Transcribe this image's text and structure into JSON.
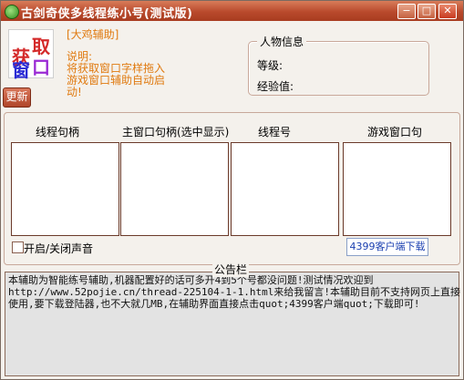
{
  "window": {
    "title": "古剑奇侠多线程练小号(测试版)",
    "buttons": {
      "minimize": "−",
      "maximize": "□",
      "close": "✕"
    }
  },
  "logo": {
    "chars": [
      "获",
      "取",
      "窗",
      "口"
    ]
  },
  "helper": {
    "title": "[大鸡辅助]",
    "desc_lines": [
      "说明:",
      "将获取窗口字样拖入",
      "游戏窗口辅助自动启",
      "动!"
    ]
  },
  "character_info": {
    "title": "人物信息",
    "level_label": "等级:",
    "exp_label": "经验值:"
  },
  "refresh_button": "更新",
  "columns": [
    "线程句柄",
    "主窗口句柄(选中显示)",
    "线程号",
    "游戏窗口句"
  ],
  "sound_toggle_label": "开启/关闭声音",
  "download_link": "4399客户端下载",
  "notice": {
    "label": "公告栏",
    "lines": [
      "本辅助为智能练号辅助,机器配置好的话可多开4到5个号都没问题!测试情况欢迎到",
      "http://www.52pojie.cn/thread-225104-1-1.html来给我留言!本辅助目前不支持网页上直接",
      "使用,要下载登陆器,也不大就几MB,在辅助界面直接点击quot;4399客户端quot;下载即可!"
    ]
  },
  "colors": {
    "titlebar": "#b94a2c",
    "accent_orange": "#e07a10",
    "link_blue": "#1a3fb0"
  }
}
